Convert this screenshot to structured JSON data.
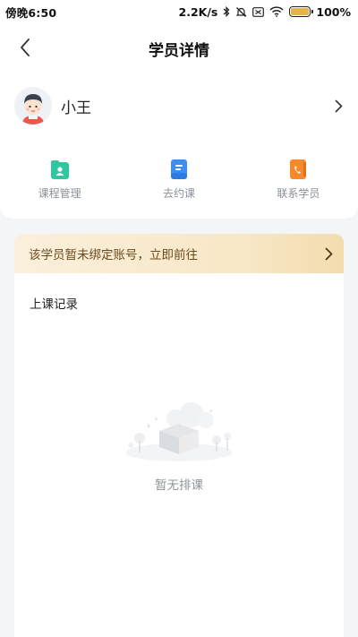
{
  "status_bar": {
    "time": "傍晚6:50",
    "network_speed": "2.2K/s",
    "battery_percent": "100%",
    "battery_level": 1.0
  },
  "nav": {
    "title": "学员详情",
    "back_icon": "chevron-left-icon"
  },
  "profile": {
    "name": "小王",
    "avatar_icon": "student-avatar-icon",
    "more_icon": "chevron-right-icon"
  },
  "actions": [
    {
      "label": "课程管理",
      "icon": "course-management-icon",
      "color": "#2fc6a0"
    },
    {
      "label": "去约课",
      "icon": "book-lesson-icon",
      "color": "#3a8ef6"
    },
    {
      "label": "联系学员",
      "icon": "contact-phone-icon",
      "color": "#f5892c"
    }
  ],
  "banner": {
    "text": "该学员暂未绑定账号，立即前往",
    "icon": "chevron-right-icon"
  },
  "records": {
    "title": "上课记录",
    "empty_text": "暂无排课",
    "empty_icon": "empty-box-illustration"
  }
}
